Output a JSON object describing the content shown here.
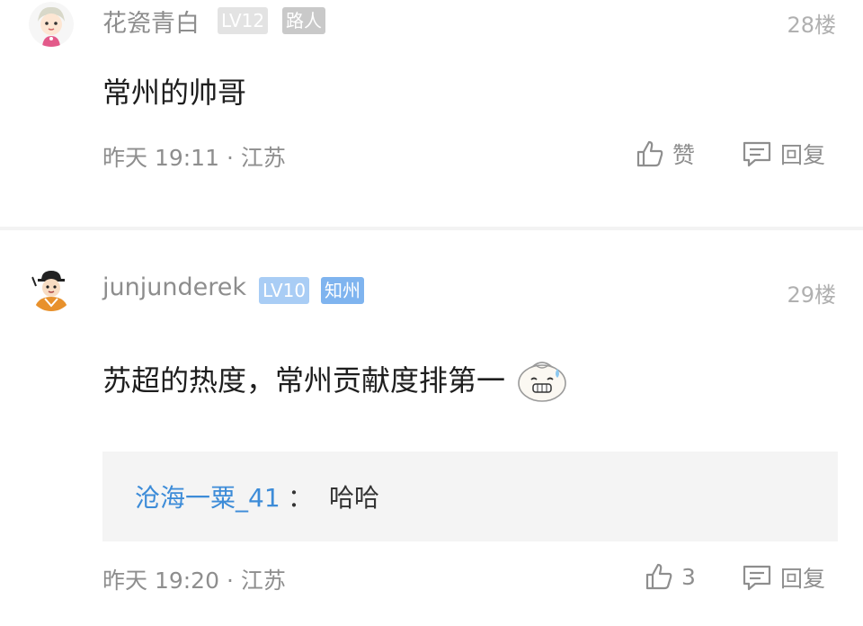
{
  "comments": [
    {
      "username": "花瓷青白",
      "level": "LV12",
      "tag": "路人",
      "floor": "28楼",
      "content": "常州的帅哥",
      "time": "昨天 19:11 · 江苏",
      "like_label": "赞",
      "reply_label": "回复",
      "avatar": "avatar-cartoon-girl"
    },
    {
      "username": "junjunderek",
      "level": "LV10",
      "tag": "知州",
      "floor": "29楼",
      "content": "苏超的热度，常州贡献度排第一",
      "emoji": "smiling-bun-emoji",
      "reply_preview": {
        "user": "沧海一粟_41",
        "colon": "：",
        "text": "哈哈"
      },
      "time": "昨天 19:20 · 江苏",
      "like_label": "3",
      "reply_label": "回复",
      "avatar": "avatar-cartoon-scholar"
    }
  ],
  "colors": {
    "link_blue": "#3d8cd8",
    "meta_gray": "#8e8e8e",
    "badge_blue": "#7fb4ef"
  }
}
